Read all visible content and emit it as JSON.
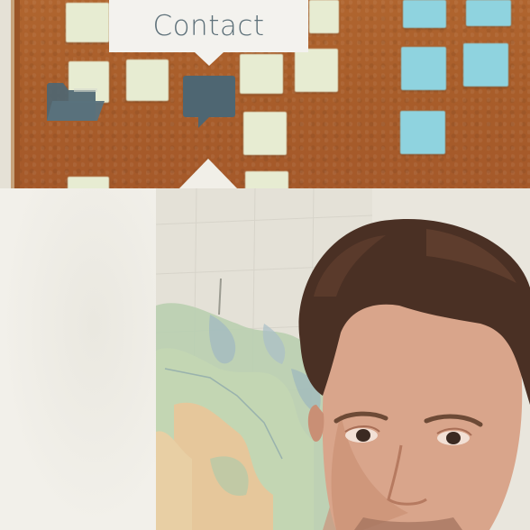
{
  "tooltip": {
    "label": "Contact"
  },
  "icons": {
    "folder": "folder-icon",
    "chat": "chat-bubble-icon"
  },
  "colors": {
    "board": "#a85d2a",
    "icon": "#4e6672",
    "tooltip_bg": "#f3f2ee",
    "tooltip_text": "#5d7079"
  },
  "photo": {
    "description": ""
  }
}
